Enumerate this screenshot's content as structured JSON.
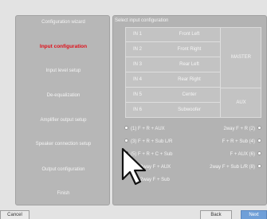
{
  "sidebar": {
    "items": [
      {
        "label": "Configuration wizard"
      },
      {
        "label": "Input configuration"
      },
      {
        "label": "Input level setup"
      },
      {
        "label": "De-equalization"
      },
      {
        "label": "Amplifier output setup"
      },
      {
        "label": "Speaker connection setup"
      },
      {
        "label": "Output configuration"
      },
      {
        "label": "Finish"
      }
    ],
    "active_index": 1
  },
  "main": {
    "title": "Select input configuration",
    "inputs": [
      {
        "no": "IN 1",
        "name": "Front Left"
      },
      {
        "no": "IN 2",
        "name": "Front Right"
      },
      {
        "no": "IN 3",
        "name": "Rear Left"
      },
      {
        "no": "IN 4",
        "name": "Rear Right"
      },
      {
        "no": "IN 5",
        "name": "Center"
      },
      {
        "no": "IN 6",
        "name": "Subwoofer"
      }
    ],
    "groups": {
      "master": "MASTER",
      "aux": "AUX"
    },
    "options": [
      {
        "left": "(1) F + R + AUX",
        "right": "2way F + R (2)"
      },
      {
        "left": "(3) F + R + Sub L/R",
        "right": "F + R + Sub (4)"
      },
      {
        "left": "(5) F + R + C + Sub",
        "right": "F + AUX (6)"
      },
      {
        "left": "2way F + AUX",
        "right": "2way F + Sub L/R (8)"
      },
      {
        "left": "2way F + Sub",
        "right": ""
      }
    ],
    "selected_option": "(5) F + R + C + Sub"
  },
  "footer": {
    "cancel_label": "Cancel",
    "back_label": "Back",
    "next_label": "Next"
  },
  "colors": {
    "active_item": "#e0101a",
    "next_button": "#6f9fd8",
    "panel": "#b3b3b3"
  },
  "icons": [
    "mouse-pointer-icon",
    "radio-button-icon"
  ]
}
